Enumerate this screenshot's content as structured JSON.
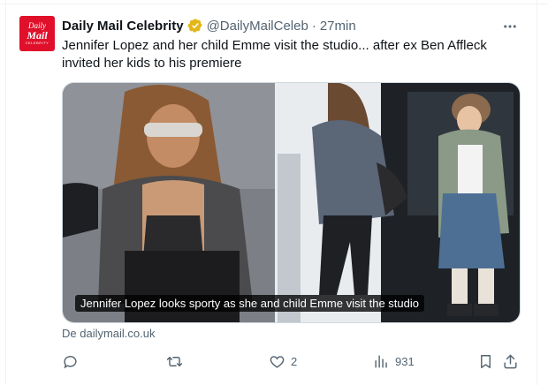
{
  "account": {
    "avatar_lines": [
      "Daily",
      "Mail",
      "CELEBRITY"
    ],
    "name": "Daily Mail Celebrity",
    "handle": "@DailyMailCeleb",
    "separator": "·",
    "time": "27min"
  },
  "tweet": {
    "text": "Jennifer Lopez and her child Emme visit the studio... after ex Ben Affleck invited her kids to his premiere"
  },
  "media": {
    "caption": "Jennifer Lopez looks sporty as she and child Emme visit the studio"
  },
  "source": "De dailymail.co.uk",
  "actions": {
    "reply_count": "",
    "retweet_count": "",
    "like_count": "2",
    "views_count": "931"
  },
  "colors": {
    "brand": "#e0102a",
    "verified": "#e2b719",
    "muted": "#536471"
  },
  "icons": [
    "more-icon",
    "verified-badge-icon",
    "reply-icon",
    "retweet-icon",
    "like-icon",
    "views-icon",
    "bookmark-icon",
    "share-icon"
  ]
}
